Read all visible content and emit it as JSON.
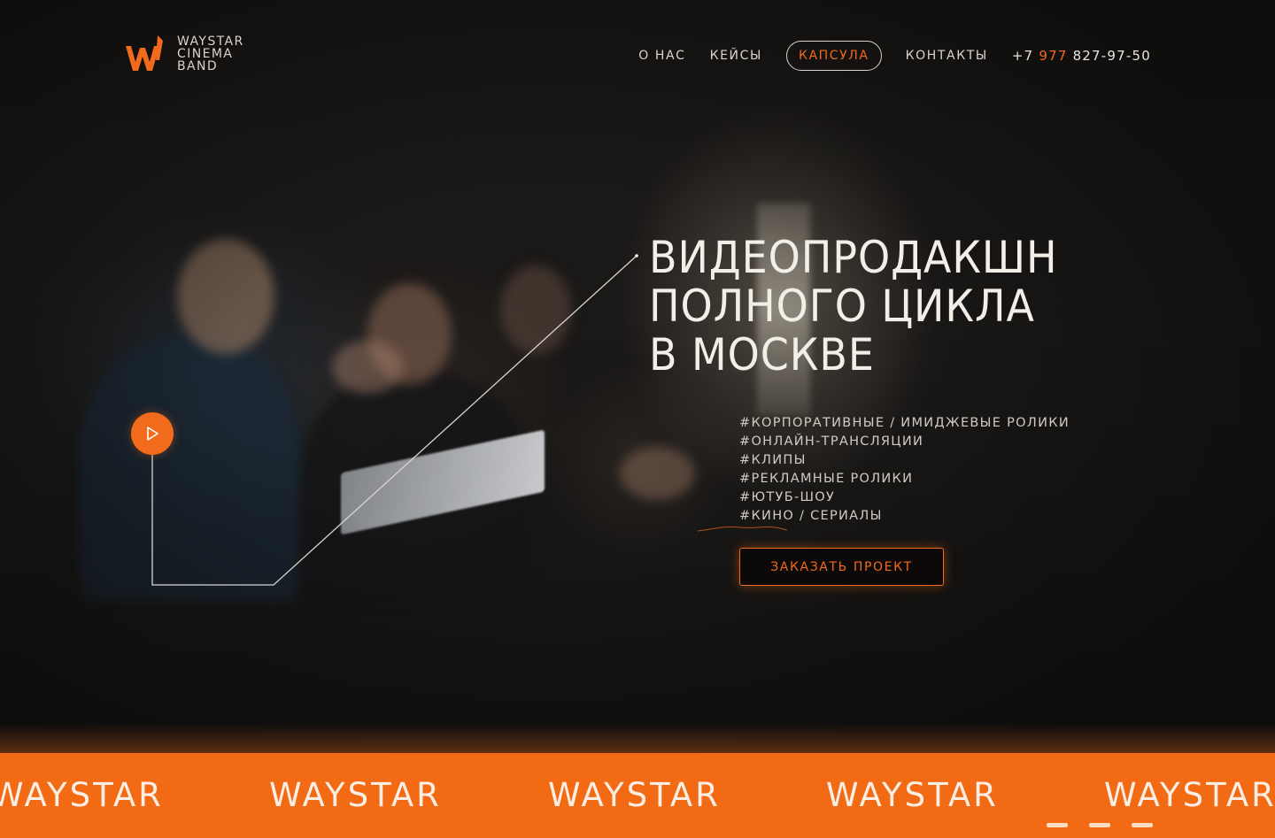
{
  "brand": {
    "lines": [
      "WAYSTAR",
      "CINEMA",
      "BAND"
    ],
    "accent_color": "#f26a1b"
  },
  "nav": {
    "items": [
      "О НАС",
      "КЕЙСЫ"
    ],
    "capsule": "КАПСУЛА",
    "contacts": "КОНТАКТЫ",
    "phone": {
      "prefix": "+7",
      "code": "977",
      "number": "827-97-50"
    }
  },
  "hero": {
    "title_lines": [
      "ВИДЕОПРОДАКШН",
      "ПОЛНОГО ЦИКЛА",
      "В МОСКВЕ"
    ],
    "tags": [
      "#КОРПОРАТИВНЫЕ / ИМИДЖЕВЫЕ РОЛИКИ",
      "#ОНЛАЙН-ТРАНСЛЯЦИИ",
      "#КЛИПЫ",
      "#РЕКЛАМНЫЕ РОЛИКИ",
      "#ЮТУБ-ШОУ",
      "#КИНО / СЕРИАЛЫ"
    ],
    "cta_label": "ЗАКАЗАТЬ ПРОЕКТ",
    "play_icon": "play-icon"
  },
  "marquee": {
    "word": "WAYSTAR",
    "background": "#f26a13"
  }
}
